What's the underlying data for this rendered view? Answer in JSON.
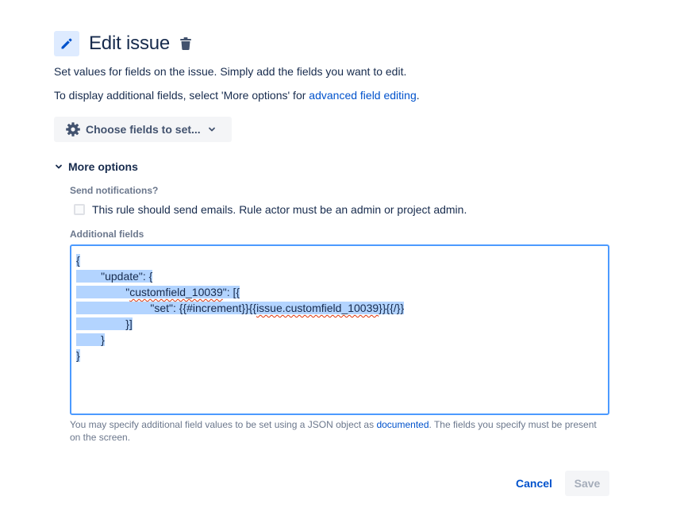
{
  "header": {
    "title": "Edit issue",
    "edit_icon": "pencil-icon",
    "delete_icon": "trash-icon"
  },
  "description": {
    "line1": "Set values for fields on the issue. Simply add the fields you want to edit.",
    "line2_prefix": "To display additional fields, select 'More options' for ",
    "line2_link": "advanced field editing",
    "line2_suffix": "."
  },
  "choose_fields": {
    "label": "Choose fields to set...",
    "icon": "gear-icon",
    "chevron": "chevron-down-icon"
  },
  "more_options": {
    "label": "More options",
    "expanded": true
  },
  "notifications": {
    "label": "Send notifications?",
    "checkbox_text": "This rule should send emails. Rule actor must be an admin or project admin.",
    "checked": false
  },
  "additional_fields": {
    "label": "Additional fields",
    "json_lines": [
      {
        "indent": "",
        "text": "{"
      },
      {
        "indent": "        ",
        "text": "\"update\": {"
      },
      {
        "indent": "                ",
        "text": "\"customfield_10039\": [{"
      },
      {
        "indent": "                        ",
        "text": "\"set\": {{#increment}}{{issue.customfield_10039}}{{/}}"
      },
      {
        "indent": "                ",
        "text": "}]"
      },
      {
        "indent": "        ",
        "text": "}"
      },
      {
        "indent": "",
        "text": "}"
      }
    ],
    "helper_prefix": "You may specify additional field values to be set using a JSON object as ",
    "helper_link": "documented",
    "helper_suffix": ". The fields you specify must be present on the screen."
  },
  "footer": {
    "cancel_label": "Cancel",
    "save_label": "Save"
  },
  "colors": {
    "link": "#0052cc",
    "focus_border": "#4c9aff",
    "selection": "#b3d4ff"
  }
}
